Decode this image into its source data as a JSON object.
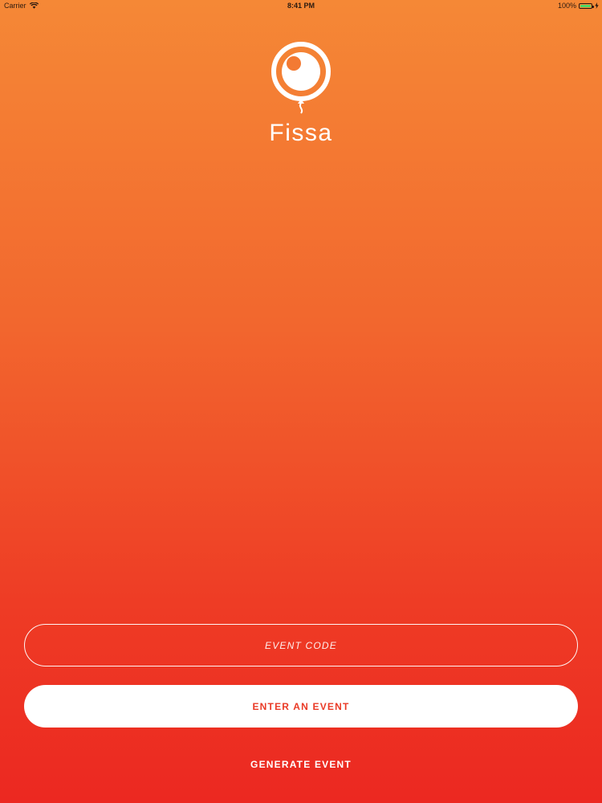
{
  "status_bar": {
    "carrier": "Carrier",
    "time": "8:41 PM",
    "battery_percent": "100%",
    "battery_level": 1.0,
    "battery_color": "#4cd964",
    "icons": [
      "wifi-icon",
      "battery-icon",
      "charging-bolt-icon"
    ]
  },
  "brand": {
    "name": "Fissa",
    "logo_icon": "balloon-logo-icon"
  },
  "form": {
    "event_code_placeholder": "EVENT CODE",
    "event_code_value": "",
    "enter_event_label": "ENTER AN EVENT",
    "generate_event_label": "GENERATE EVENT"
  },
  "colors": {
    "gradient_top": "#f58836",
    "gradient_bottom": "#ec2821",
    "button_text": "#ea3a26",
    "foreground": "#ffffff"
  }
}
